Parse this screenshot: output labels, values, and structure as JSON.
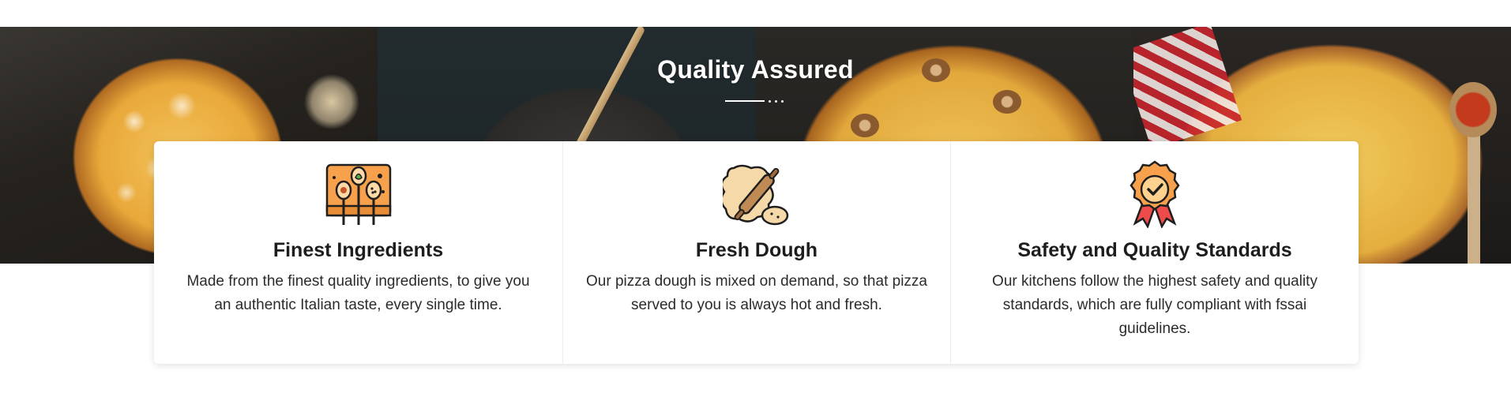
{
  "section": {
    "title": "Quality Assured"
  },
  "features": [
    {
      "icon": "spoons-icon",
      "title": "Finest Ingredients",
      "description": "Made from the finest quality ingredients, to give you an authentic Italian taste, every single time."
    },
    {
      "icon": "rolling-pin-dough-icon",
      "title": "Fresh Dough",
      "description": "Our pizza dough is mixed on demand, so that pizza served to you is always hot and fresh."
    },
    {
      "icon": "quality-badge-icon",
      "title": "Safety and Quality Standards",
      "description": "Our kitchens follow the highest safety and quality standards, which are fully compliant with fssai guidelines."
    }
  ],
  "colors": {
    "icon_orange": "#f7a14c",
    "icon_outline": "#1f1f1f",
    "badge_red": "#ef4b4b",
    "dough": "#f6d9a8",
    "rolling_pin": "#c08a55"
  }
}
